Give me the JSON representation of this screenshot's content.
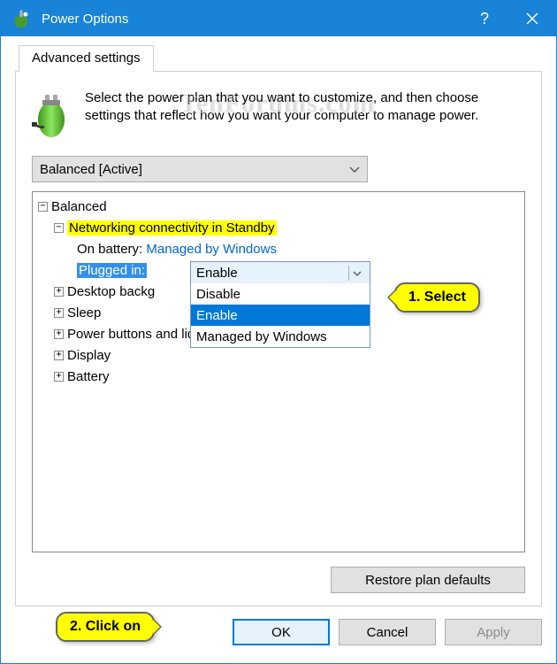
{
  "window": {
    "title": "Power Options"
  },
  "tab": {
    "label": "Advanced settings"
  },
  "watermark": "TenForums.com",
  "intro": "Select the power plan that you want to customize, and then choose settings that reflect how you want your computer to manage power.",
  "plan_select": {
    "value": "Balanced [Active]"
  },
  "tree": {
    "root": "Balanced",
    "expanded_item": "Networking connectivity in Standby",
    "on_battery_label": "On battery:",
    "on_battery_value": "Managed by Windows",
    "plugged_in_label": "Plugged in:",
    "plugged_in_value": "Enable",
    "collapsed": {
      "i0": "Desktop backg",
      "i1": "Sleep",
      "i2": "Power buttons and lid",
      "i3": "Display",
      "i4": "Battery"
    }
  },
  "combo": {
    "selected": "Enable",
    "options": {
      "o0": "Disable",
      "o1": "Enable",
      "o2": "Managed by Windows"
    }
  },
  "buttons": {
    "restore": "Restore plan defaults",
    "ok": "OK",
    "cancel": "Cancel",
    "apply": "Apply"
  },
  "callouts": {
    "select": "1. Select",
    "click": "2. Click on"
  }
}
